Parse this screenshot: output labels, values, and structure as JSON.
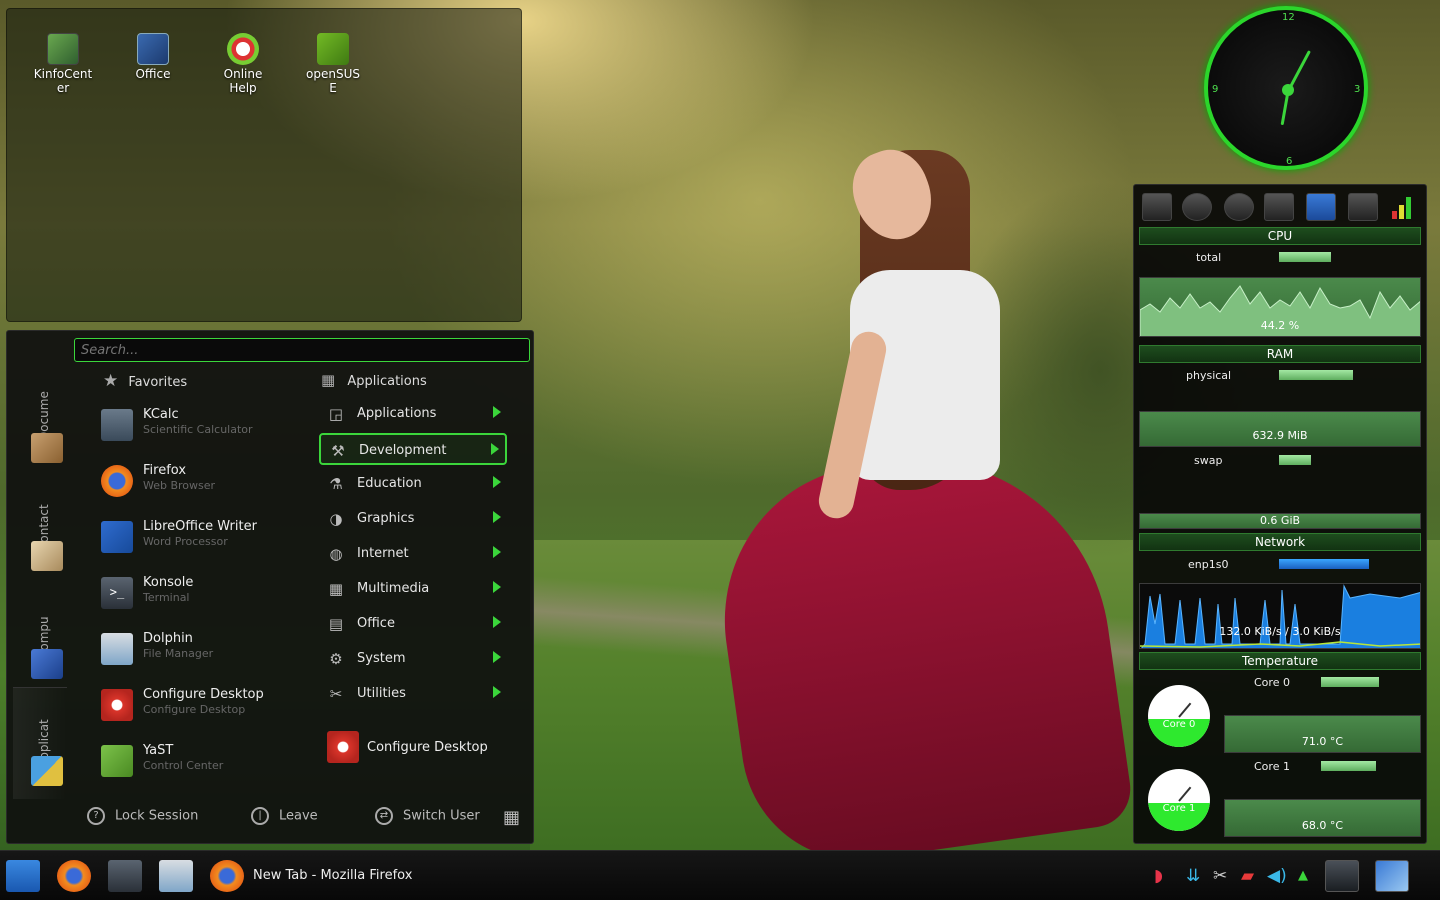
{
  "desktop": {
    "icons": [
      {
        "label": "KinfoCent\ner",
        "name": "kinfocenter"
      },
      {
        "label": "Office",
        "name": "office"
      },
      {
        "label": "Online\nHelp",
        "name": "online-help"
      },
      {
        "label": "openSUS\nE",
        "name": "opensuse"
      }
    ]
  },
  "launcher": {
    "search_placeholder": "Search...",
    "side_tabs": [
      "Docume",
      "Contact",
      "Compu",
      "Applicat"
    ],
    "favorites_header": "Favorites",
    "favorites": [
      {
        "title": "KCalc",
        "subtitle": "Scientific Calculator"
      },
      {
        "title": "Firefox",
        "subtitle": "Web Browser"
      },
      {
        "title": "LibreOffice Writer",
        "subtitle": "Word Processor"
      },
      {
        "title": "Konsole",
        "subtitle": "Terminal"
      },
      {
        "title": "Dolphin",
        "subtitle": "File Manager"
      },
      {
        "title": "Configure Desktop",
        "subtitle": "Configure Desktop"
      },
      {
        "title": "YaST",
        "subtitle": "Control Center"
      }
    ],
    "applications_header": "Applications",
    "categories": [
      {
        "label": "Applications",
        "icon": "◲"
      },
      {
        "label": "Development",
        "icon": "⚒"
      },
      {
        "label": "Education",
        "icon": "⚗"
      },
      {
        "label": "Graphics",
        "icon": "◑"
      },
      {
        "label": "Internet",
        "icon": "◍"
      },
      {
        "label": "Multimedia",
        "icon": "▦"
      },
      {
        "label": "Office",
        "icon": "▤"
      },
      {
        "label": "System",
        "icon": "⚙"
      },
      {
        "label": "Utilities",
        "icon": "✂"
      }
    ],
    "selected_category": "Development",
    "configure_desktop": "Configure Desktop",
    "bottom": {
      "lock": "Lock Session",
      "leave": "Leave",
      "switch_user": "Switch User"
    }
  },
  "clock": {
    "n12": "12",
    "n3": "3",
    "n6": "6",
    "n9": "9"
  },
  "sysmon": {
    "cpu": {
      "title": "CPU",
      "label": "total",
      "value": "44.2 %"
    },
    "ram": {
      "title": "RAM",
      "physical_label": "physical",
      "physical_value": "632.9 MiB",
      "swap_label": "swap",
      "swap_value": "0.6 GiB"
    },
    "network": {
      "title": "Network",
      "iface": "enp1s0",
      "value": "132.0 KiB/s / 3.0 KiB/s"
    },
    "temperature": {
      "title": "Temperature",
      "core0_label": "Core 0",
      "core0_gauge": "Core 0",
      "core0_value": "71.0 °C",
      "core1_label": "Core 1",
      "core1_gauge": "Core 1",
      "core1_value": "68.0 °C"
    }
  },
  "taskbar": {
    "window_title": "New Tab - Mozilla Firefox"
  },
  "colors": {
    "accent": "#3bd63b",
    "network": "#1a7fe0"
  }
}
